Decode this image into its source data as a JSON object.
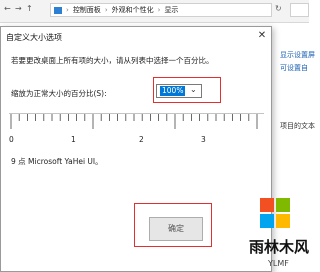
{
  "explorer": {
    "breadcrumb": [
      "控制面板",
      "外观和个性化",
      "显示"
    ]
  },
  "background": {
    "link1": "显示设置屏",
    "link2": "可设置自",
    "text1": "项目的文本",
    "bottom": "显"
  },
  "dialog": {
    "title": "自定义大小选项",
    "close": "✕",
    "instruction": "若要更改桌面上所有项的大小，请从列表中选择一个百分比。",
    "scale_label": "缩放为正常大小的百分比(S):",
    "scale_value": "100%",
    "ruler_labels": [
      "0",
      "1",
      "2",
      "3"
    ],
    "font_info": "9 点 Microsoft YaHei UI。",
    "ok_button": "确定"
  },
  "watermark": {
    "brand_text": "雨林木风",
    "sub_text": "YLMF"
  },
  "colors": {
    "highlight_red": "#e03030",
    "select_blue": "#0078d7"
  }
}
